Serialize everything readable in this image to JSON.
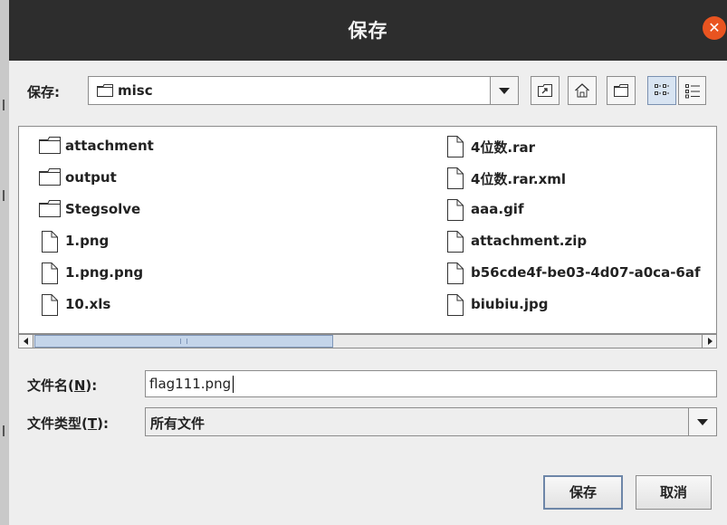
{
  "dialog": {
    "title": "保存",
    "close_icon": "close-icon"
  },
  "lookin": {
    "label": "保存:",
    "value": "misc",
    "icon": "folder-icon"
  },
  "toolbar": {
    "buttons": [
      {
        "icon": "up-one-level-icon"
      },
      {
        "icon": "home-icon"
      },
      {
        "icon": "new-folder-icon"
      },
      {
        "icon": "list-view-icon",
        "pressed": true
      },
      {
        "icon": "details-view-icon"
      }
    ]
  },
  "files": {
    "col1": [
      {
        "name": "attachment",
        "icon": "folder-icon"
      },
      {
        "name": "output",
        "icon": "folder-icon"
      },
      {
        "name": "Stegsolve",
        "icon": "folder-icon"
      },
      {
        "name": "1.png",
        "icon": "file-icon"
      },
      {
        "name": "1.png.png",
        "icon": "file-icon"
      },
      {
        "name": "10.xls",
        "icon": "file-icon"
      }
    ],
    "col2": [
      {
        "name": "4位数.rar",
        "icon": "file-icon"
      },
      {
        "name": "4位数.rar.xml",
        "icon": "file-icon"
      },
      {
        "name": "aaa.gif",
        "icon": "file-icon"
      },
      {
        "name": "attachment.zip",
        "icon": "file-icon"
      },
      {
        "name": "b56cde4f-be03-4d07-a0ca-6af",
        "icon": "file-icon"
      },
      {
        "name": "biubiu.jpg",
        "icon": "file-icon"
      }
    ]
  },
  "filename": {
    "label_pre": "文件名(",
    "mnemonic": "N",
    "label_post": "):",
    "value": "flag111.png"
  },
  "filetype": {
    "label_pre": "文件类型(",
    "mnemonic": "T",
    "label_post": "):",
    "value": "所有文件"
  },
  "actions": {
    "save": "保存",
    "cancel": "取消"
  },
  "colors": {
    "titlebar": "#2d2d2d",
    "close": "#e95420",
    "selection": "#c4d5ea"
  }
}
